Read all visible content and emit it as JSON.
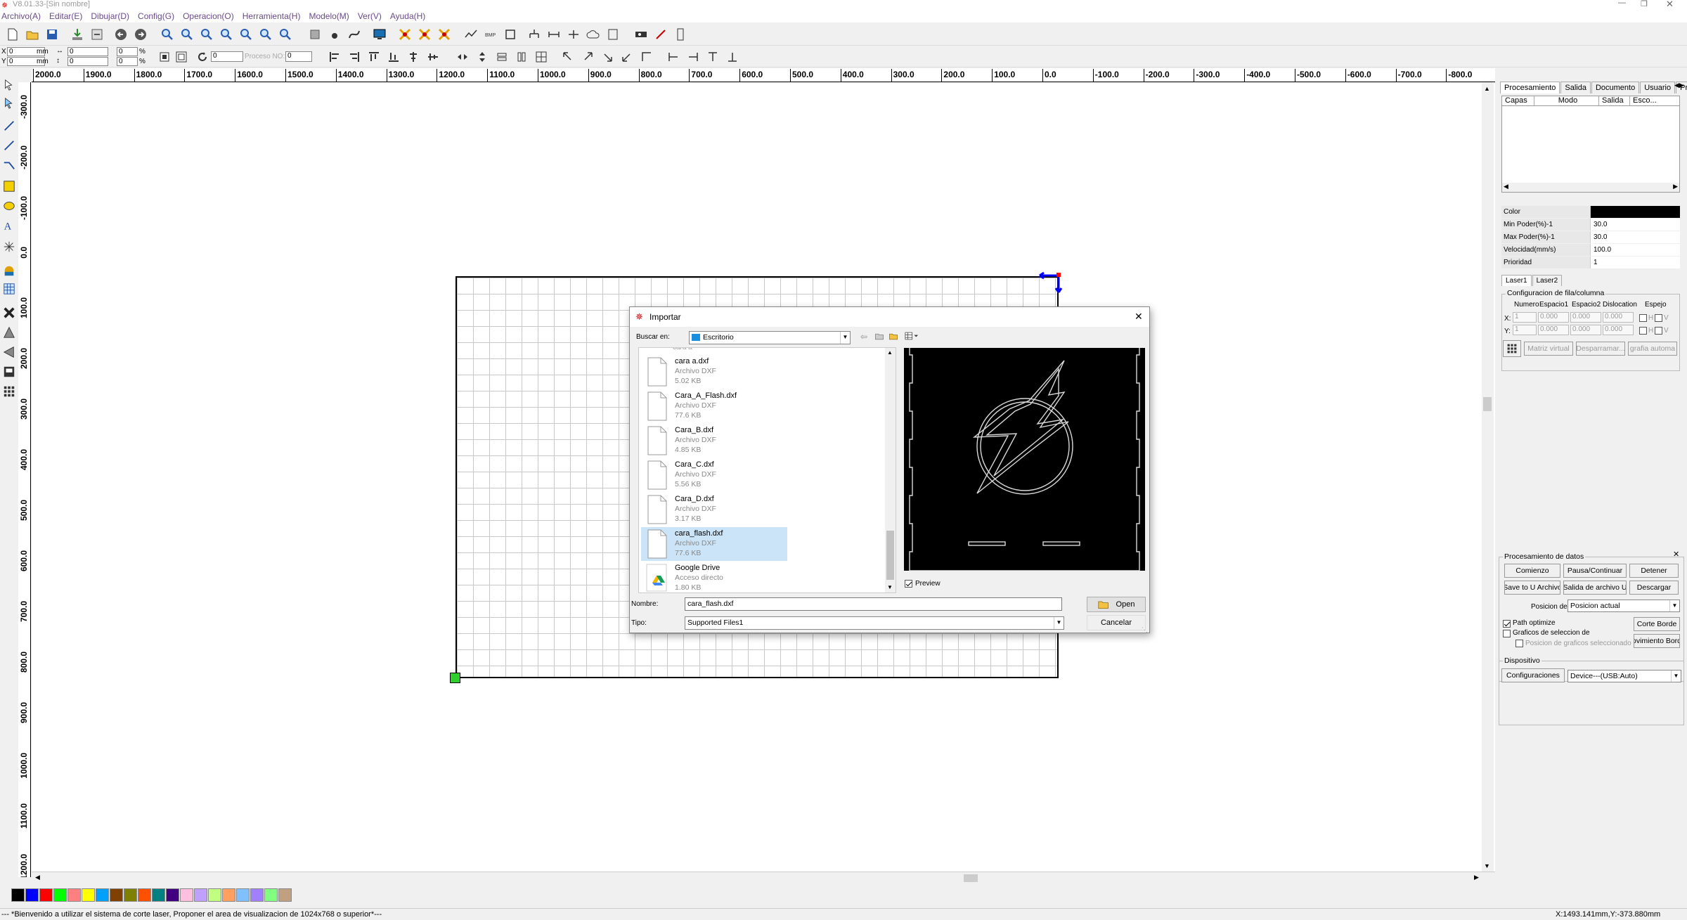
{
  "window": {
    "title": "V8.01.33-[Sin nombre]"
  },
  "menu": [
    "Archivo(A)",
    "Editar(E)",
    "Dibujar(D)",
    "Config(G)",
    "Operacion(O)",
    "Herramienta(H)",
    "Modelo(M)",
    "Ver(V)",
    "Ayuda(H)"
  ],
  "toolbar2": {
    "x_label": "X",
    "y_label": "Y",
    "x_value": "0",
    "y_value": "0",
    "mm1": "mm",
    "mm2": "mm",
    "w_value": "0",
    "h_value": "0",
    "pct1": "0",
    "pct2": "0",
    "pct_sym": "%",
    "rot_value": "0",
    "proceso_label": "Proceso NO:",
    "proceso_value": "0"
  },
  "ruler_h": [
    "2000.0",
    "1900.0",
    "1800.0",
    "1700.0",
    "1600.0",
    "1500.0",
    "1400.0",
    "1300.0",
    "1200.0",
    "1100.0",
    "1000.0",
    "900.0",
    "800.0",
    "700.0",
    "600.0",
    "500.0",
    "400.0",
    "300.0",
    "200.0",
    "100.0",
    "0.0",
    "-100.0",
    "-200.0",
    "-300.0",
    "-400.0",
    "-500.0",
    "-600.0",
    "-700.0",
    "-800.0"
  ],
  "ruler_v": [
    "100.0",
    "200.0",
    "300.0",
    "400.0",
    "500.0",
    "600.0",
    "700.0",
    "800.0",
    "900.0",
    "1000.0",
    "1100.0",
    "1200.0"
  ],
  "ruler_v_prefix": [
    "-300.0",
    "-200.0",
    "-100.0",
    "0.0",
    "100.0",
    "200.0",
    "300.0",
    "400.0",
    "500.0",
    "600.0",
    "700.0",
    "800.0",
    "900.0",
    "1000.0",
    "1100.0",
    "1200.0"
  ],
  "palette": [
    "#000000",
    "#0000ff",
    "#ff0000",
    "#00ff00",
    "#ff8080",
    "#ffff00",
    "#00a0ff",
    "#804000",
    "#808000",
    "#ff5000",
    "#008080",
    "#400080",
    "#ffc0e0",
    "#c0a0ff",
    "#c0ff80",
    "#ffa060",
    "#80c0ff",
    "#a080ff",
    "#80ff80",
    "#c0a080"
  ],
  "status": {
    "message": "--- *Bienvenido a utilizar el sistema de corte laser, Proponer el area de visualizacion de 1024x768 o superior*---",
    "coords": "X:1493.141mm,Y:-373.880mm"
  },
  "right_panel": {
    "tabs": [
      "Procesamiento",
      "Salida",
      "Documento",
      "Usuario",
      "Pru"
    ],
    "layer_headers": [
      "Capas",
      "Modo",
      "Salida",
      "Esco..."
    ],
    "props": [
      {
        "k": "Color",
        "v": ""
      },
      {
        "k": "Min Poder(%)-1",
        "v": "30.0"
      },
      {
        "k": "Max Poder(%)-1",
        "v": "30.0"
      },
      {
        "k": "Velocidad(mm/s)",
        "v": "100.0"
      },
      {
        "k": "Prioridad",
        "v": "1"
      }
    ],
    "laser_tabs": [
      "Laser1",
      "Laser2"
    ],
    "array_group": "Configuracion de fila/columna",
    "array_headers": [
      "Numero",
      "Espacio1",
      "Espacio2",
      "Dislocation",
      "Espejo"
    ],
    "array_x": {
      "label": "X:",
      "n": "1",
      "e1": "0.000",
      "e2": "0.000",
      "d": "0.000",
      "h": "H",
      "v": "V"
    },
    "array_y": {
      "label": "Y:",
      "n": "1",
      "e1": "0.000",
      "e2": "0.000",
      "d": "0.000",
      "h": "H",
      "v": "V"
    },
    "array_buttons": [
      "Matriz virtual",
      "Desparramar...",
      "grafia automa"
    ],
    "proc_group": "Procesamiento de datos",
    "btn_comienzo": "Comienzo",
    "btn_pausa": "Pausa/Continuar",
    "btn_detener": "Detener",
    "btn_save_u": "Save to U Archivo",
    "btn_salida_u": "Salida de archivo U",
    "btn_descargar": "Descargar",
    "posicion_label": "Posicion de",
    "posicion_value": "Posicion actual",
    "path_optimize": "Path optimize",
    "graficos_sel": "Graficos de seleccion de",
    "posicion_graficos": "Posicion de graficos seleccionado",
    "btn_corte_borde": "Corte Borde",
    "btn_movimiento": "ovimiento Bord",
    "dispositivo_group": "Dispositivo",
    "btn_config": "Configuraciones",
    "device_value": "Device---(USB:Auto)"
  },
  "dialog": {
    "title": "Importar",
    "buscar_label": "Buscar en:",
    "buscar_value": "Escritorio",
    "files": [
      {
        "name": "cara a.dxf",
        "type": "Archivo DXF",
        "size": "5.02 KB"
      },
      {
        "name": "Cara_A_Flash.dxf",
        "type": "Archivo DXF",
        "size": "77.6 KB"
      },
      {
        "name": "Cara_B.dxf",
        "type": "Archivo DXF",
        "size": "4.85 KB"
      },
      {
        "name": "Cara_C.dxf",
        "type": "Archivo DXF",
        "size": "5.56 KB"
      },
      {
        "name": "Cara_D.dxf",
        "type": "Archivo DXF",
        "size": "3.17 KB"
      },
      {
        "name": "cara_flash.dxf",
        "type": "Archivo DXF",
        "size": "77.6 KB"
      },
      {
        "name": "Google Drive",
        "type": "Acceso directo",
        "size": "1.80 KB"
      }
    ],
    "preview_label": "Preview",
    "nombre_label": "Nombre:",
    "nombre_value": "cara_flash.dxf",
    "tipo_label": "Tipo:",
    "tipo_value": "Supported Files1",
    "open_label": "Open",
    "cancel_label": "Cancelar"
  }
}
